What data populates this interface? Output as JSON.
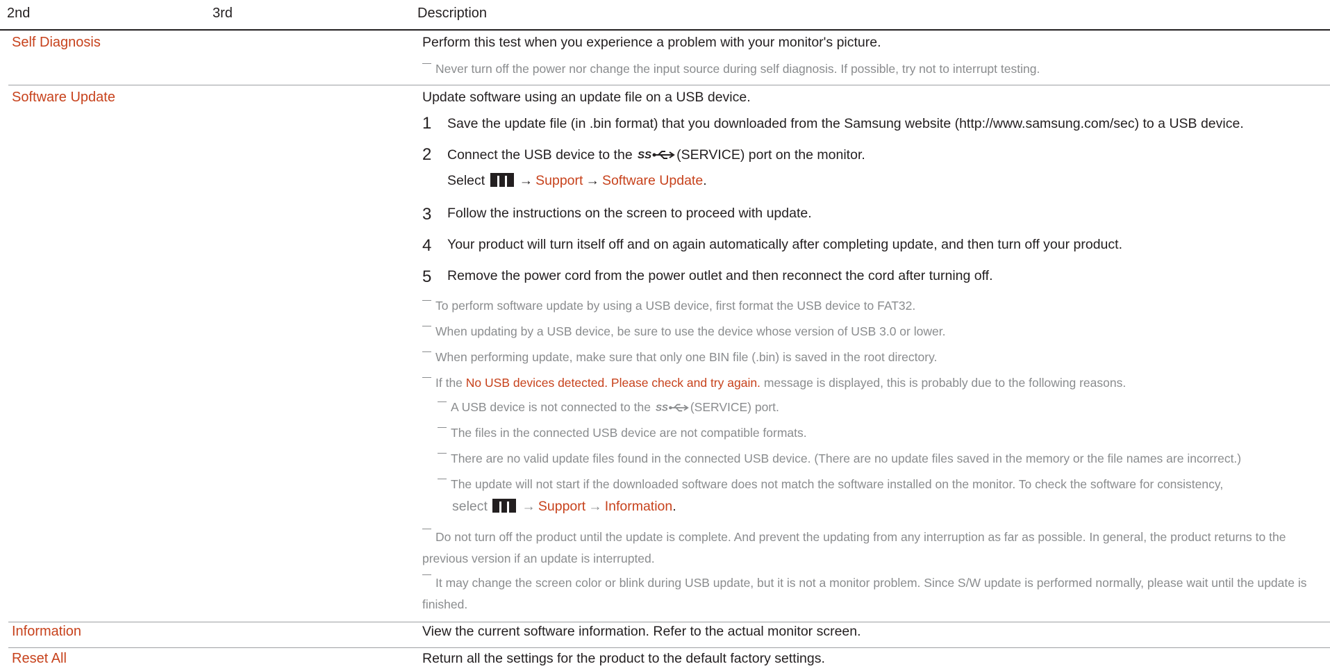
{
  "header": {
    "col_2nd": "2nd",
    "col_3rd": "3rd",
    "col_desc": "Description"
  },
  "self_diagnosis": {
    "label": "Self Diagnosis",
    "desc": "Perform this test when you experience a problem with your monitor's picture.",
    "note": "Never turn off the power nor change the input source during self diagnosis. If possible, try not to interrupt testing."
  },
  "software_update": {
    "label": "Software Update",
    "intro": "Update software using an update file on a USB device.",
    "steps": [
      {
        "num": "1",
        "text": "Save the update file (in .bin format) that you downloaded from the Samsung website (http://www.samsung.com/sec) to a USB device."
      },
      {
        "num": "2",
        "text_before": "Connect the USB device to the",
        "text_port": "(SERVICE)",
        "text_after": "port on the monitor.",
        "select_prefix": "Select",
        "arrow": "→",
        "menu_support": "Support",
        "menu_update": "Software Update",
        "period": "."
      },
      {
        "num": "3",
        "text": "Follow the instructions on the screen to proceed with update."
      },
      {
        "num": "4",
        "text": "Your product will turn itself off and on again automatically after completing update, and then turn off your product."
      },
      {
        "num": "5",
        "text": "Remove the power cord from the power outlet and then reconnect the cord after turning off."
      }
    ],
    "notes": [
      "To perform software update by using a USB device, first format the USB device to FAT32.",
      "When updating by a USB device, be sure to use the device whose version of USB 3.0 or lower.",
      "When performing update, make sure that only one BIN file (.bin) is saved in the root directory."
    ],
    "note_msg": {
      "before": "If the",
      "message": "No USB devices detected. Please check and try again.",
      "after": "message is displayed, this is probably due to the following reasons."
    },
    "sub_notes": {
      "port_before": "A USB device is not connected to the",
      "port_after": "(SERVICE) port.",
      "incompatible": "The files in the connected USB device are not compatible formats.",
      "no_valid": "There are no valid update files found in the connected USB device. (There are no update files saved in the memory or the file names are incorrect.)",
      "mismatch_line1": "The update will not start if the downloaded software does not match the software installed on the monitor. To check the software for consistency,",
      "select_prefix": "select",
      "arrow": "→",
      "menu_support": "Support",
      "menu_info": "Information",
      "period": "."
    },
    "note_interrupt": "Do not turn off the product until the update is complete. And prevent the updating from any interruption as far as possible. In general, the product returns to the previous version if an update is interrupted.",
    "note_blink": "It may change the screen color or blink during USB update, but it is not a monitor problem. Since S/W update is performed normally, please wait until the update is finished."
  },
  "information": {
    "label": "Information",
    "desc": "View the current software information. Refer to the actual monitor screen."
  },
  "reset_all": {
    "label": "Reset All",
    "desc": "Return all the settings for the product to the default factory settings."
  },
  "icons": {
    "usb": "usb-superspeed-icon",
    "menu": "menu-icon"
  },
  "colors": {
    "accent": "#c7421c",
    "text": "#231f20",
    "note": "#8a8c8e"
  }
}
